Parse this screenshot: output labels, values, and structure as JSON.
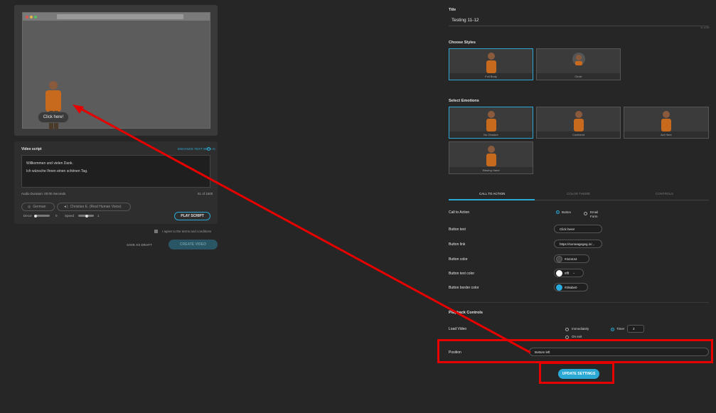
{
  "preview": {
    "click_button_label": "Click here!"
  },
  "script": {
    "title": "Video script",
    "enhance_label": "ENHANCE TEXT WITH AI",
    "text_line1": "Willkommen und vielen Dank.",
    "text_line2": "Ich wünsche Ihnen einen schönen Tag.",
    "audio_duration": "Audio Duration: 00:00 Seconds",
    "char_count": "61 of 1500",
    "language": "German",
    "voice": "Christian E. (Real Human Voice)",
    "decor_label": "Decor",
    "decor_value": "0",
    "speed_label": "Speed",
    "speed_value": "1",
    "play_label": "PLAY SCRIPT"
  },
  "terms": "I agree to the terms and conditions",
  "actions": {
    "save_draft": "SAVE AS DRAFT",
    "create_video": "CREATE VIDEO"
  },
  "settings": {
    "title_label": "Title",
    "title_value": "Testing 11-12",
    "char_hint": "11 of 50",
    "styles_label": "Choose Styles",
    "styles": [
      "Full Body",
      "Circle"
    ],
    "emotions_label": "Select Emotions",
    "emotions": [
      "No Gesture",
      "Confident",
      "Act Here",
      "Waving Hand"
    ],
    "tabs": [
      "CALL TO ACTION",
      "COLOR THEME",
      "CONTROLS"
    ],
    "cta_label": "Call to Action",
    "cta_options": [
      "Button",
      "Email Form"
    ],
    "button_text_label": "Button text",
    "button_text_value": "Click here!",
    "button_link_label": "Button link",
    "button_link_value": "https://someagegeg.in/...",
    "button_color_label": "Button color",
    "button_color_value": "#444444",
    "button_text_color_label": "Button text color",
    "button_text_color_value": "#fff",
    "button_border_color_label": "Button border color",
    "button_border_color_value": "#29abe0",
    "playback_label": "Playback Controls",
    "load_video_label": "Load Video",
    "load_options": [
      "Immediately",
      "On exit",
      "Timer"
    ],
    "timer_value": "2",
    "position_label": "Position",
    "position_value": "Bottom left",
    "update_label": "UPDATE SETTINGS"
  },
  "colors": {
    "accent": "#2ba9d4",
    "annotation": "#e60000",
    "background": "#262626"
  }
}
